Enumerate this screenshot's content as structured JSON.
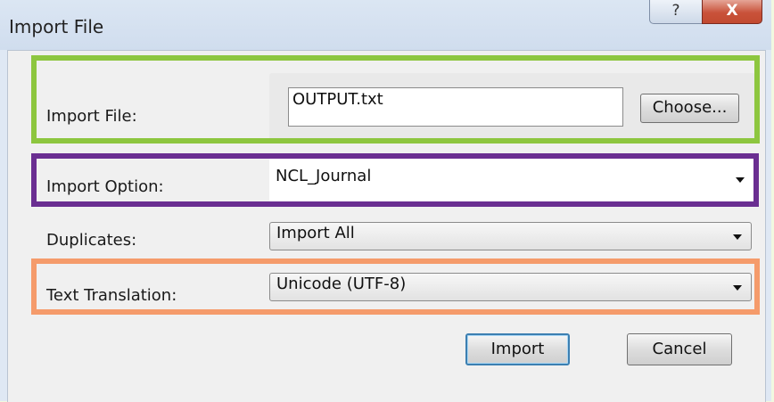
{
  "window": {
    "title": "Import File",
    "help_glyph": "?",
    "close_glyph": "X"
  },
  "import_file": {
    "label": "Import File:",
    "value": "OUTPUT.txt",
    "choose_label": "Choose..."
  },
  "import_option": {
    "label": "Import Option:",
    "selected": "NCL_Journal"
  },
  "duplicates": {
    "label": "Duplicates:",
    "selected": "Import All"
  },
  "text_translation": {
    "label": "Text Translation:",
    "selected": "Unicode (UTF-8)"
  },
  "buttons": {
    "import_label": "Import",
    "cancel_label": "Cancel"
  },
  "highlights": {
    "import_file_color": "#8dc63f",
    "import_option_color": "#6a2e91",
    "text_translation_color": "#f59b6b"
  }
}
